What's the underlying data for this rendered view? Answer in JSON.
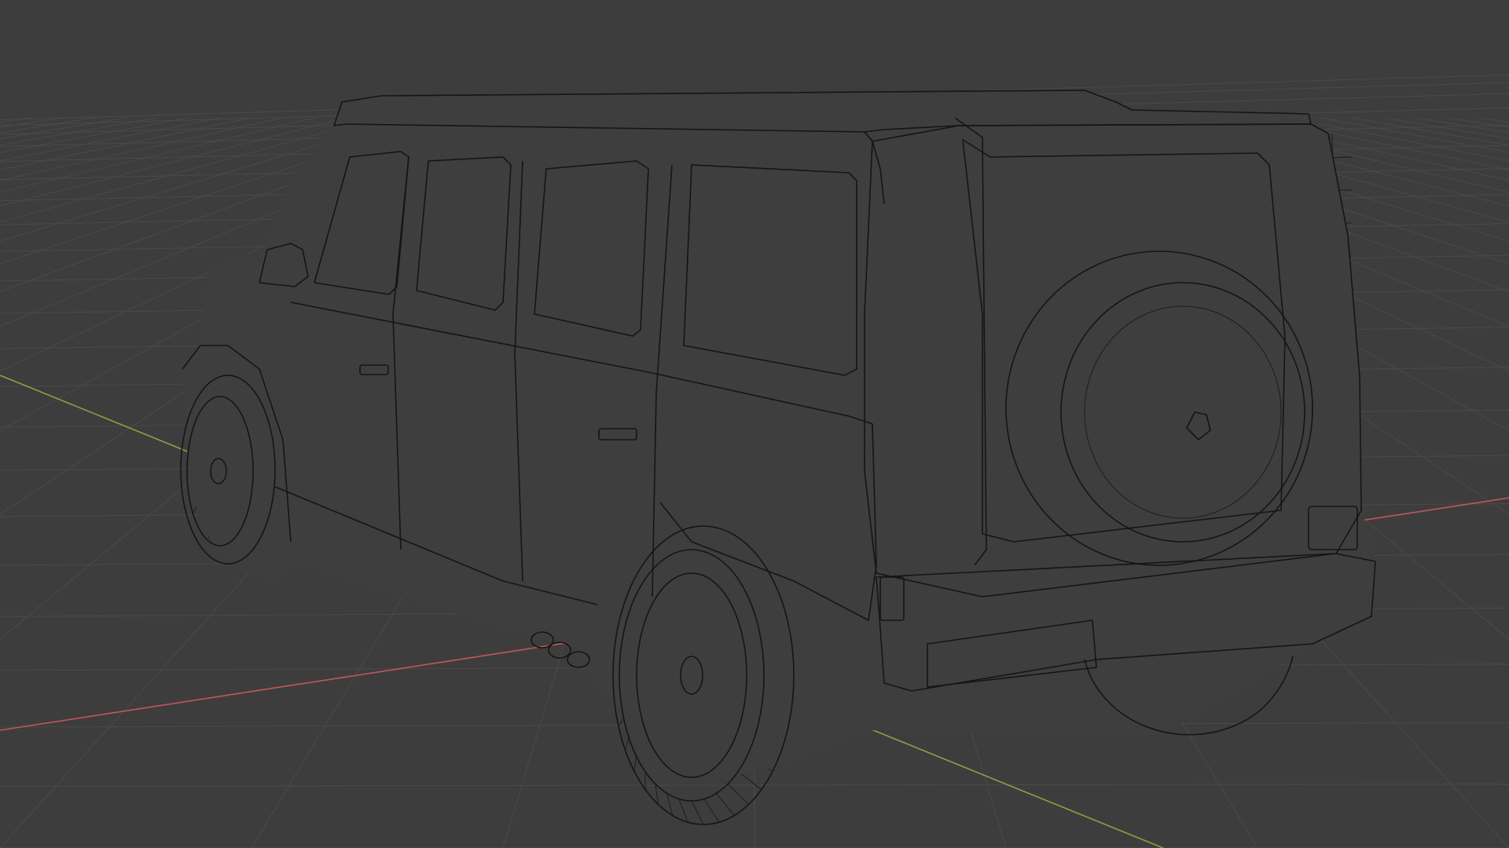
{
  "viewport": {
    "background_color": "#3d3d3d",
    "grid_color": "#4a4a4a",
    "wire_color": "#151515",
    "x_axis_color": "#c2565e",
    "y_axis_color": "#86a345",
    "shading_mode": "wireframe",
    "object_kind": "boxy SUV / off-road wagon mesh, rear three-quarter view"
  }
}
